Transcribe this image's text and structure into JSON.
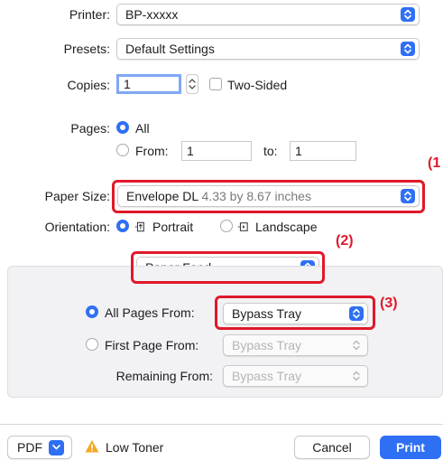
{
  "printer": {
    "label": "Printer:",
    "value": "BP-xxxxx"
  },
  "presets": {
    "label": "Presets:",
    "value": "Default Settings"
  },
  "copies": {
    "label": "Copies:",
    "value": "1",
    "two_sided_label": "Two-Sided"
  },
  "pages": {
    "label": "Pages:",
    "all_label": "All",
    "from_label": "From:",
    "from_value": "1",
    "to_label": "to:",
    "to_value": "1"
  },
  "paper_size": {
    "label": "Paper Size:",
    "value": "Envelope DL",
    "dimensions": "4.33 by 8.67 inches"
  },
  "orientation": {
    "label": "Orientation:",
    "portrait_label": "Portrait",
    "landscape_label": "Landscape"
  },
  "section_popup": {
    "value": "Paper Feed"
  },
  "paper_feed": {
    "all_pages_label": "All Pages From:",
    "all_pages_value": "Bypass Tray",
    "first_page_label": "First Page From:",
    "first_page_value": "Bypass Tray",
    "remaining_label": "Remaining From:",
    "remaining_value": "Bypass Tray"
  },
  "callouts": {
    "c1": "(1",
    "c2": "(2)",
    "c3": "(3)"
  },
  "footer": {
    "pdf_label": "PDF",
    "low_toner_label": "Low Toner",
    "cancel_label": "Cancel",
    "print_label": "Print"
  },
  "colors": {
    "accent": "#2f6ff4",
    "callout_red": "#e0192a",
    "warning": "#f5a623"
  }
}
